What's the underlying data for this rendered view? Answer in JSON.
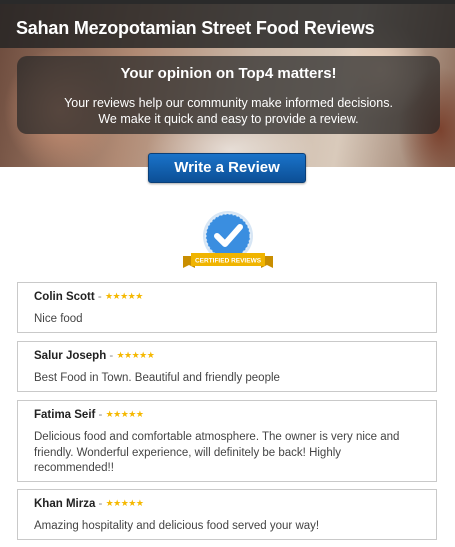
{
  "header": {
    "title": "Sahan Mezopotamian Street Food Reviews"
  },
  "info": {
    "heading": "Your opinion on Top4 matters!",
    "line1": "Your reviews help our community make informed decisions.",
    "line2": "We make it quick and easy to provide a review."
  },
  "actions": {
    "write_review_label": "Write a Review"
  },
  "badge": {
    "label": "CERTIFIED REVIEWS",
    "icon": "checkmark-icon",
    "colors": {
      "circle": "#3a8ee0",
      "ribbon": "#f0b400"
    }
  },
  "reviews": [
    {
      "name": "Colin Scott",
      "rating": 5,
      "text": "Nice food"
    },
    {
      "name": "Salur Joseph",
      "rating": 5,
      "text": "Best Food in Town. Beautiful and friendly people"
    },
    {
      "name": "Fatima Seif",
      "rating": 5,
      "text": "Delicious food and comfortable atmosphere. The owner is very nice and friendly. Wonderful experience, will definitely be back! Highly recommended!!"
    },
    {
      "name": "Khan Mirza",
      "rating": 5,
      "text": "Amazing hospitality and delicious food served your way!"
    }
  ],
  "colors": {
    "accent": "#1565c0",
    "star": "#f5b800"
  }
}
